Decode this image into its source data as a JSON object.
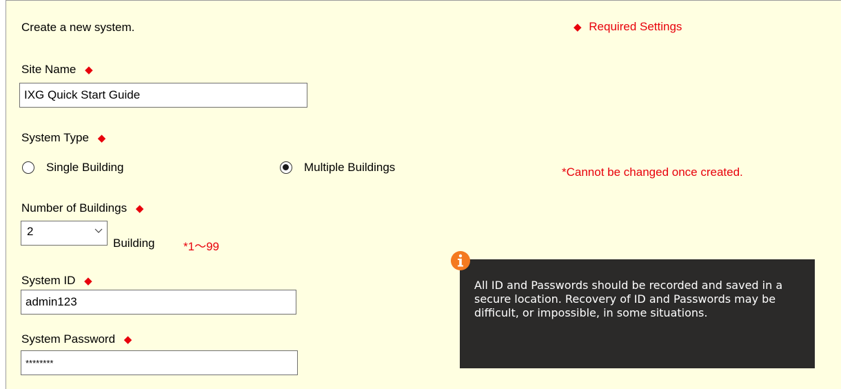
{
  "header": {
    "intro": "Create a new system.",
    "required_marker": "◆",
    "required_label": "Required Settings"
  },
  "site_name": {
    "label": "Site Name",
    "value": "IXG Quick Start Guide"
  },
  "system_type": {
    "label": "System Type",
    "options": [
      {
        "label": "Single Building",
        "selected": false
      },
      {
        "label": "Multiple Buildings",
        "selected": true
      }
    ],
    "note": "*Cannot be changed once created."
  },
  "buildings": {
    "label": "Number of Buildings",
    "value": "2",
    "unit": "Building",
    "range": "*1～99"
  },
  "system_id": {
    "label": "System ID",
    "value": "admin123"
  },
  "system_password": {
    "label": "System Password",
    "value": "********"
  },
  "tooltip": {
    "icon": "info-icon",
    "text": "All ID and Passwords should be recorded and saved in a secure location. Recovery of ID and Passwords may be difficult, or impossible, in some situations."
  },
  "colors": {
    "panel_bg": "#ffffe1",
    "required": "#e8000b",
    "tooltip_bg": "#2b2a29",
    "info_icon": "#f47a20"
  }
}
